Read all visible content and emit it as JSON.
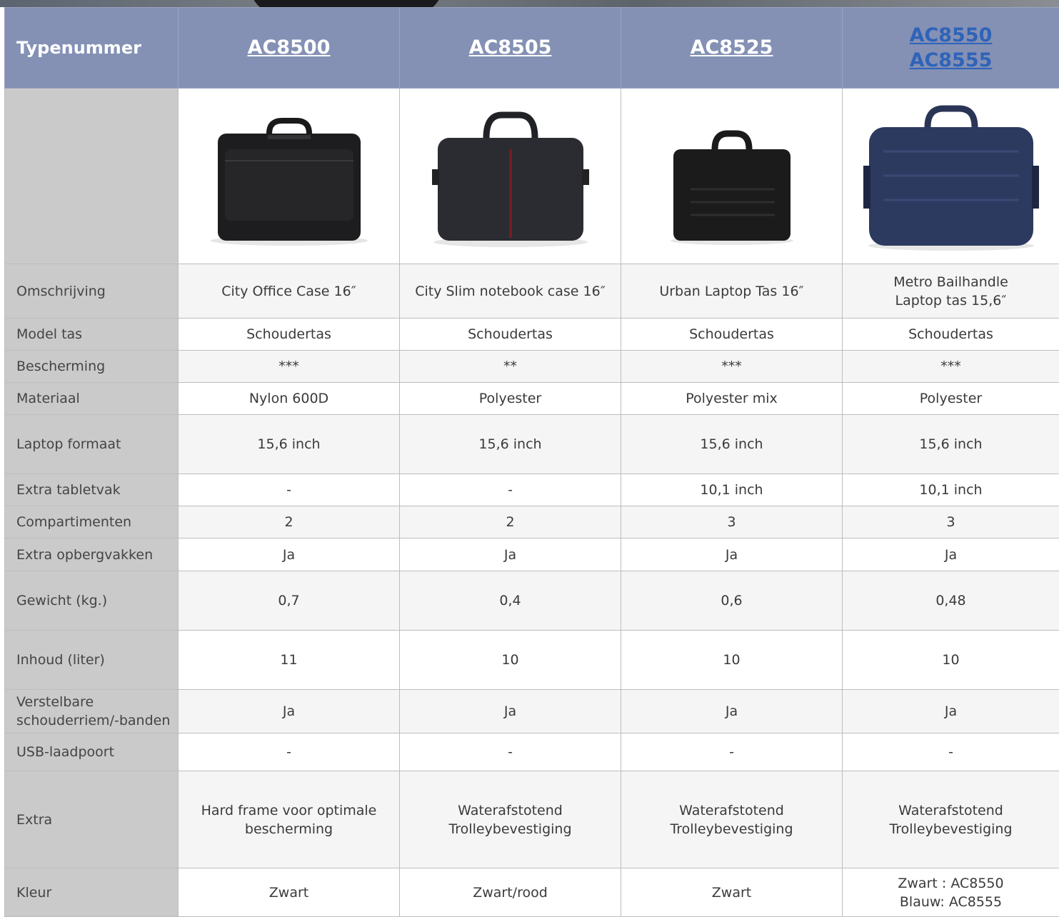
{
  "header": {
    "row_label": "Typenummer",
    "models": [
      {
        "lines": [
          "AC8500"
        ],
        "link_color": "#ffffff"
      },
      {
        "lines": [
          "AC8505"
        ],
        "link_color": "#ffffff"
      },
      {
        "lines": [
          "AC8525"
        ],
        "link_color": "#ffffff"
      },
      {
        "lines": [
          "AC8550",
          "AC8555"
        ],
        "link_color": "#2f63b8"
      }
    ]
  },
  "colors": {
    "header_bg": "#8491b5",
    "label_bg": "#cacaca",
    "alt_row_bg": "#f5f5f5"
  },
  "product_images": [
    {
      "name": "black-office-case",
      "color": "#1d1d1f"
    },
    {
      "name": "dark-slim-case-red-stripe",
      "color": "#2a2c31"
    },
    {
      "name": "black-urban-laptop-bag",
      "color": "#1b1b1c"
    },
    {
      "name": "blue-metro-laptop-bag",
      "color": "#2c3a60"
    }
  ],
  "rows": [
    {
      "label": [
        "Omschrijving"
      ],
      "values": [
        [
          "City Office Case 16″"
        ],
        [
          "City Slim notebook case 16″"
        ],
        [
          "Urban Laptop Tas 16″"
        ],
        [
          "Metro Bailhandle",
          "Laptop tas 15,6″"
        ]
      ]
    },
    {
      "label": [
        "Model tas"
      ],
      "values": [
        [
          "Schoudertas"
        ],
        [
          "Schoudertas"
        ],
        [
          "Schoudertas"
        ],
        [
          "Schoudertas"
        ]
      ]
    },
    {
      "label": [
        "Bescherming"
      ],
      "values": [
        [
          "***"
        ],
        [
          "**"
        ],
        [
          "***"
        ],
        [
          "***"
        ]
      ]
    },
    {
      "label": [
        "Materiaal"
      ],
      "values": [
        [
          "Nylon 600D"
        ],
        [
          "Polyester"
        ],
        [
          "Polyester mix"
        ],
        [
          "Polyester"
        ]
      ]
    },
    {
      "label": [
        "Laptop formaat"
      ],
      "values": [
        [
          "15,6 inch"
        ],
        [
          "15,6 inch"
        ],
        [
          "15,6 inch"
        ],
        [
          "15,6 inch"
        ]
      ]
    },
    {
      "label": [
        "Extra tabletvak"
      ],
      "values": [
        [
          "-"
        ],
        [
          "-"
        ],
        [
          "10,1 inch"
        ],
        [
          "10,1 inch"
        ]
      ]
    },
    {
      "label": [
        "Compartimenten"
      ],
      "values": [
        [
          "2"
        ],
        [
          "2"
        ],
        [
          "3"
        ],
        [
          "3"
        ]
      ]
    },
    {
      "label": [
        "Extra opbergvakken"
      ],
      "values": [
        [
          "Ja"
        ],
        [
          "Ja"
        ],
        [
          "Ja"
        ],
        [
          "Ja"
        ]
      ]
    },
    {
      "label": [
        "Gewicht (kg.)"
      ],
      "values": [
        [
          "0,7"
        ],
        [
          "0,4"
        ],
        [
          "0,6"
        ],
        [
          "0,48"
        ]
      ]
    },
    {
      "label": [
        "Inhoud (liter)"
      ],
      "values": [
        [
          "11"
        ],
        [
          "10"
        ],
        [
          "10"
        ],
        [
          "10"
        ]
      ]
    },
    {
      "label": [
        "Verstelbare",
        "schouderriem/-banden"
      ],
      "values": [
        [
          "Ja"
        ],
        [
          "Ja"
        ],
        [
          "Ja"
        ],
        [
          "Ja"
        ]
      ]
    },
    {
      "label": [
        "USB-laadpoort"
      ],
      "values": [
        [
          "-"
        ],
        [
          "-"
        ],
        [
          "-"
        ],
        [
          "-"
        ]
      ]
    },
    {
      "label": [
        "Extra"
      ],
      "values": [
        [
          "Hard frame voor optimale",
          "bescherming"
        ],
        [
          "Waterafstotend",
          "Trolleybevestiging"
        ],
        [
          "Waterafstotend",
          "Trolleybevestiging"
        ],
        [
          "Waterafstotend",
          "Trolleybevestiging"
        ]
      ]
    },
    {
      "label": [
        "Kleur"
      ],
      "values": [
        [
          "Zwart"
        ],
        [
          "Zwart/rood"
        ],
        [
          "Zwart"
        ],
        [
          "Zwart : AC8550",
          "Blauw: AC8555"
        ]
      ]
    }
  ]
}
